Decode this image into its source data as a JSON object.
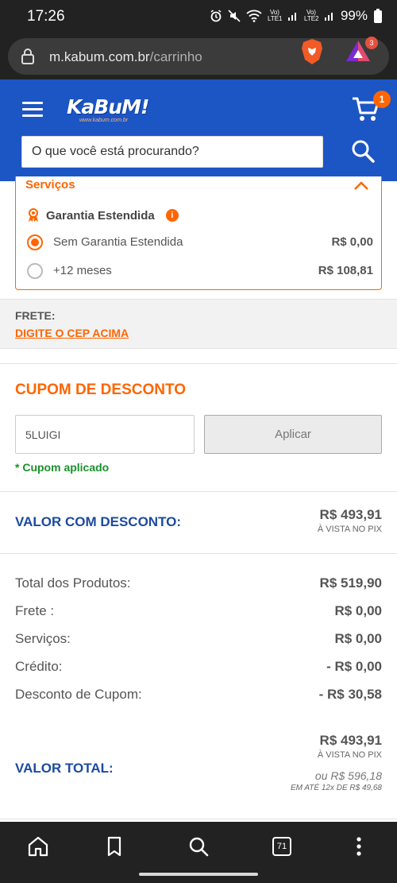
{
  "status_bar": {
    "time": "17:26",
    "battery": "99%",
    "sim1": "Vo) LTE1",
    "sim2": "Vo) LTE2"
  },
  "browser": {
    "url_domain": "m.kabum.com.br",
    "url_path": "/carrinho",
    "rewards_badge": "3",
    "tab_count": "71"
  },
  "header": {
    "logo_text": "KaBuM!",
    "logo_sub": "www.kabum.com.br",
    "cart_count": "1",
    "search_placeholder": "O que você está procurando?"
  },
  "services": {
    "title": "Serviços",
    "warranty_label": "Garantia Estendida",
    "info_glyph": "i",
    "options": [
      {
        "label": "Sem Garantia Estendida",
        "price": "R$ 0,00",
        "selected": true
      },
      {
        "label": "+12 meses",
        "price": "R$ 108,81",
        "selected": false
      }
    ]
  },
  "frete": {
    "label": "FRETE:",
    "cep_link": "DIGITE O CEP ACIMA"
  },
  "cupom": {
    "title": "CUPOM DE DESCONTO",
    "code": "5LUIGI",
    "apply_label": "Aplicar",
    "applied_msg": "* Cupom aplicado"
  },
  "valor_com_desconto": {
    "label": "VALOR COM DESCONTO:",
    "value": "R$ 493,91",
    "note": "À VISTA NO PIX"
  },
  "summary": [
    {
      "label": "Total dos Produtos:",
      "value": "R$ 519,90"
    },
    {
      "label": "Frete :",
      "value": "R$ 0,00"
    },
    {
      "label": "Serviços:",
      "value": "R$ 0,00"
    },
    {
      "label": "Crédito:",
      "value": "- R$ 0,00"
    },
    {
      "label": "Desconto de Cupom:",
      "value": "- R$ 30,58"
    }
  ],
  "valor_total": {
    "label": "VALOR TOTAL:",
    "value": "R$ 493,91",
    "note": "À VISTA NO PIX",
    "alt_price": "ou R$ 596,18",
    "installments": "EM ATÉ 12x DE R$ 49,68"
  },
  "colors": {
    "brand_blue": "#1c55c4",
    "accent_orange": "#ff6500",
    "success_green": "#19912a"
  }
}
